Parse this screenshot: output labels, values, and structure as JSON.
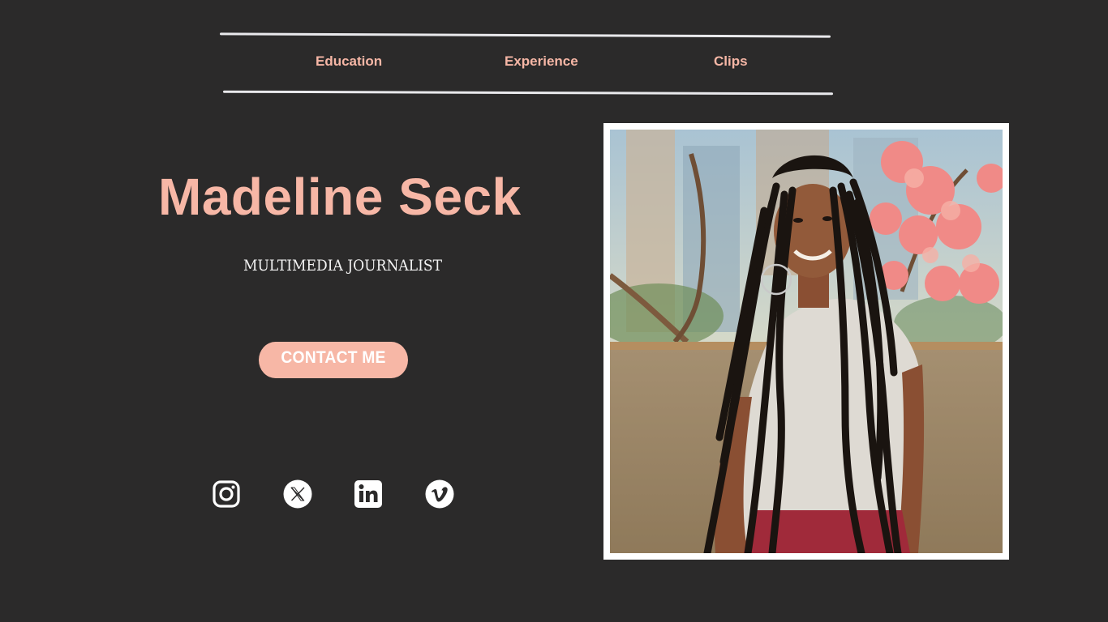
{
  "nav": {
    "items": [
      {
        "label": "Education"
      },
      {
        "label": "Experience"
      },
      {
        "label": "Clips"
      }
    ]
  },
  "hero": {
    "name": "Madeline Seck",
    "subtitle": "MULTIMEDIA JOURNALIST",
    "contact_label": "CONTACT ME"
  },
  "social": {
    "icons": [
      "instagram-icon",
      "x-twitter-icon",
      "linkedin-icon",
      "vimeo-icon"
    ]
  },
  "colors": {
    "background": "#2b2a2a",
    "accent": "#f7b7a6",
    "nav_line": "#e9e9ec",
    "text_light": "#f2f2f2",
    "photo_frame": "#ffffff"
  }
}
